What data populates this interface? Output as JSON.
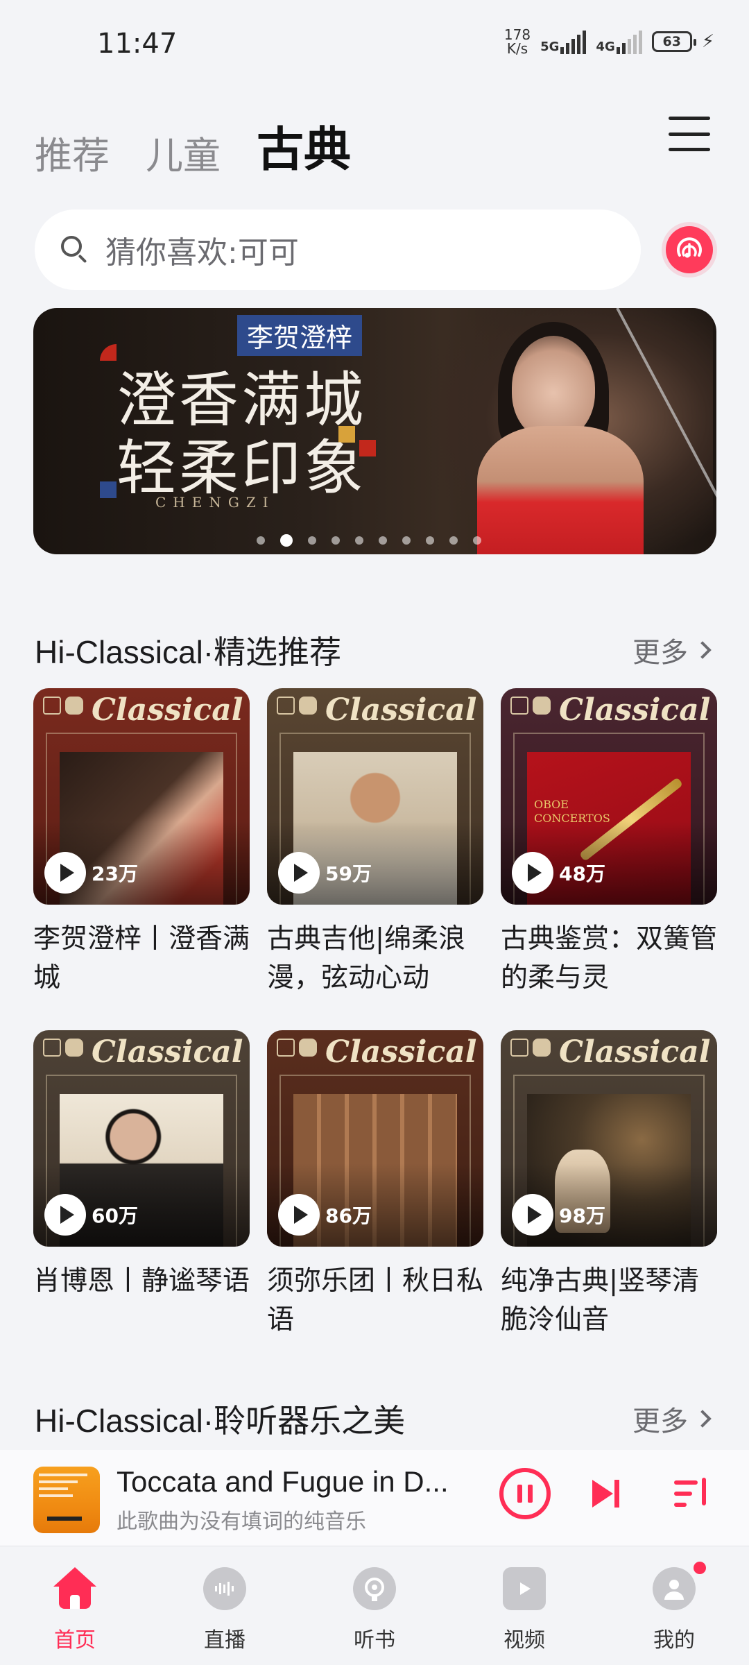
{
  "status_bar": {
    "time": "11:47",
    "net_speed_value": "178",
    "net_speed_unit": "K/s",
    "signal1_label": "5G",
    "signal2_label": "4G",
    "battery": "63"
  },
  "top_tabs": [
    {
      "label": "推荐",
      "active": false
    },
    {
      "label": "儿童",
      "active": false
    },
    {
      "label": "古典",
      "active": true
    }
  ],
  "search": {
    "placeholder": "猜你喜欢:可可"
  },
  "banner": {
    "subtitle": "李贺澄梓",
    "title_line1": "澄香满城",
    "title_line2": "轻柔印象",
    "english": "CHENGZI",
    "page_count": 10,
    "active_index": 1
  },
  "section1": {
    "title": "Hi-Classical·精选推荐",
    "more": "更多",
    "cards": [
      {
        "brand": "Classical",
        "count": "23万",
        "title": "李贺澄梓丨澄香满城"
      },
      {
        "brand": "Classical",
        "count": "59万",
        "title": "古典吉他|绵柔浪漫，弦动心动"
      },
      {
        "brand": "Classical",
        "count": "48万",
        "title": "古典鉴赏：双簧管的柔与灵",
        "cover_text": "OBOE CONCERTOS"
      },
      {
        "brand": "Classical",
        "count": "60万",
        "title": "肖博恩丨静谧琴语"
      },
      {
        "brand": "Classical",
        "count": "86万",
        "title": "须弥乐团丨秋日私语"
      },
      {
        "brand": "Classical",
        "count": "98万",
        "title": "纯净古典|竖琴清脆泠仙音"
      }
    ]
  },
  "section2": {
    "title": "Hi-Classical·聆听器乐之美",
    "more": "更多"
  },
  "player": {
    "title": "Toccata and Fugue in D...",
    "subtitle": "此歌曲为没有填词的纯音乐"
  },
  "bottom_nav": [
    {
      "label": "首页",
      "icon": "home-icon",
      "active": true
    },
    {
      "label": "直播",
      "icon": "live-icon",
      "active": false
    },
    {
      "label": "听书",
      "icon": "audiobook-icon",
      "active": false
    },
    {
      "label": "视频",
      "icon": "video-icon",
      "active": false
    },
    {
      "label": "我的",
      "icon": "profile-icon",
      "active": false
    }
  ],
  "colors": {
    "accent": "#ff2d55",
    "background": "#f3f4f7"
  }
}
